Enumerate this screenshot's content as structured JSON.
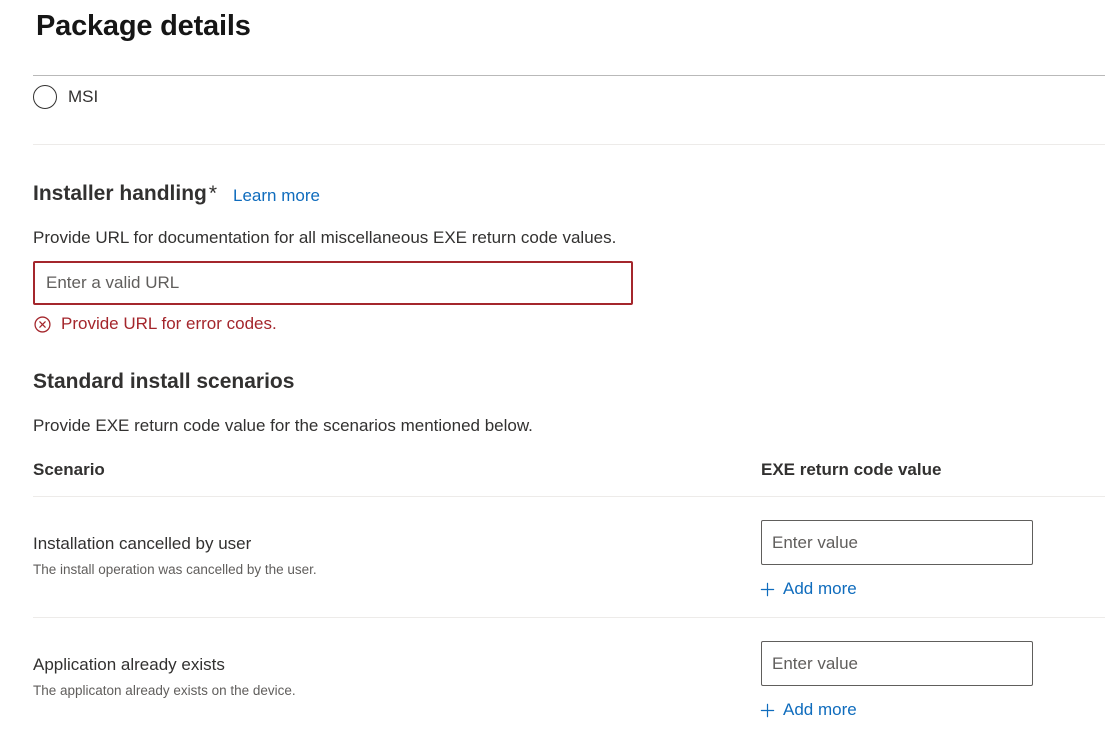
{
  "header": {
    "title": "Package details"
  },
  "package_type": {
    "option_msi_label": "MSI",
    "selected": false
  },
  "installer_handling": {
    "heading": "Installer handling",
    "required_mark": "*",
    "learn_more": "Learn more",
    "description": "Provide URL for documentation for all miscellaneous EXE return code values.",
    "url_placeholder": "Enter a valid URL",
    "url_value": "",
    "error_text": "Provide URL for error codes."
  },
  "standard_scenarios": {
    "heading": "Standard install scenarios",
    "description": "Provide EXE return code value for the scenarios mentioned below.",
    "columns": {
      "scenario": "Scenario",
      "return_code": "EXE return code value"
    },
    "rows": [
      {
        "name": "Installation cancelled by user",
        "description": "The install operation was cancelled by the user.",
        "value_placeholder": "Enter value",
        "value": "",
        "add_more": "Add more"
      },
      {
        "name": "Application already exists",
        "description": "The applicaton already exists on the device.",
        "value_placeholder": "Enter value",
        "value": "",
        "add_more": "Add more"
      }
    ]
  },
  "colors": {
    "link": "#0f6cbd",
    "error": "#a4262c",
    "text": "#323130",
    "muted_text": "#605e5c"
  },
  "icons": {
    "radio": "radio-unselected-icon",
    "error": "error-circle-icon",
    "add": "plus-icon"
  }
}
